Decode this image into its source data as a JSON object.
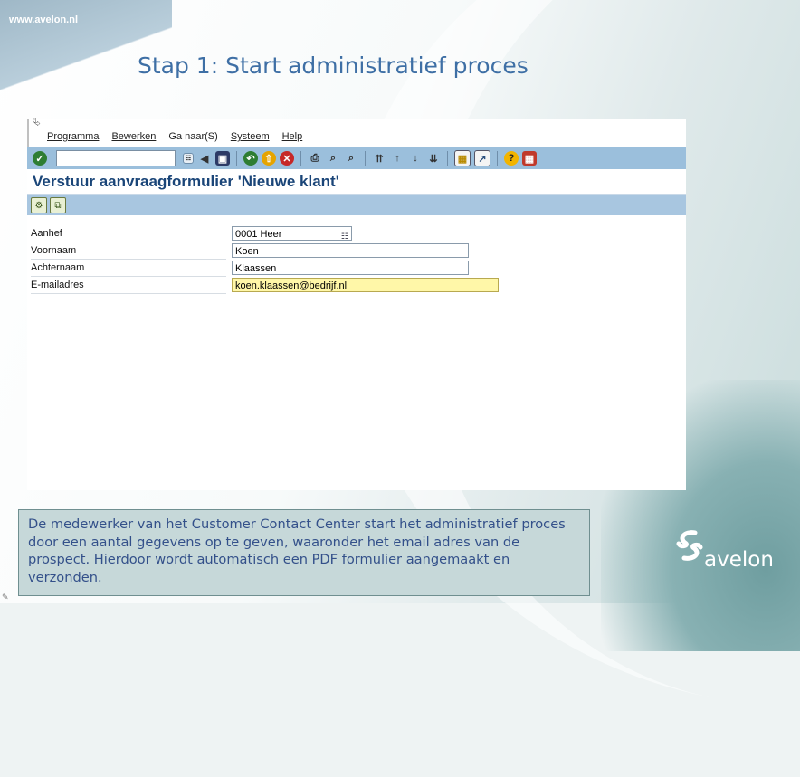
{
  "slide": {
    "url": "www.avelon.nl",
    "title": "Stap 1: Start administratief proces",
    "caption": "De medewerker van het Customer Contact Center start het administratief proces door een aantal gegevens op te geven, waaronder het email adres van de prospect. Hierdoor wordt automatisch een PDF formulier aangemaakt en verzonden.",
    "logo_text": "avelon"
  },
  "sap": {
    "menu": [
      "Programma",
      "Bewerken",
      "Ga naar(S)",
      "Systeem",
      "Help"
    ],
    "command_field": "",
    "screen_title": "Verstuur aanvraagformulier 'Nieuwe klant'",
    "form": [
      {
        "label": "Aanhef",
        "value": "0001 Heer"
      },
      {
        "label": "Voornaam",
        "value": "Koen"
      },
      {
        "label": "Achternaam",
        "value": "Klaassen"
      },
      {
        "label": "E-mailadres",
        "value": "koen.klaassen@bedrijf.nl"
      }
    ]
  },
  "colors": {
    "title_blue": "#3e6fa5",
    "toolbar_blue": "#9bbfdc",
    "active_field": "#fff7a8",
    "caption_bg": "#c6d8d9"
  },
  "icons": {
    "toolbar": [
      "enter-icon",
      "back-icon",
      "save-icon",
      "navigate-back-icon",
      "exit-icon",
      "cancel-icon",
      "print-icon",
      "find-icon",
      "find-next-icon",
      "first-page-icon",
      "prev-page-icon",
      "next-page-icon",
      "last-page-icon",
      "create-session-icon",
      "shortcut-icon",
      "help-icon",
      "layout-icon"
    ],
    "application": [
      "execute-icon",
      "copy-icon"
    ]
  }
}
